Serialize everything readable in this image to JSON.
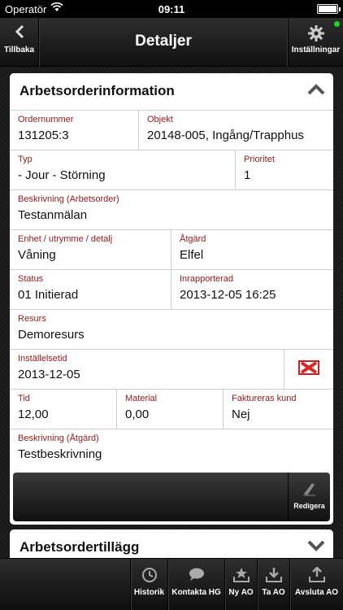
{
  "status_bar": {
    "carrier": "Operatör",
    "time": "09:11",
    "battery_level": 1.0
  },
  "nav": {
    "back_label": "Tillbaka",
    "title": "Detaljer",
    "settings_label": "Inställningar"
  },
  "work_order_panel": {
    "title": "Arbetsorderinformation",
    "fields": {
      "order_number": {
        "label": "Ordernummer",
        "value": "131205:3"
      },
      "object": {
        "label": "Objekt",
        "value": "20148-005, Ingång/Trapphus"
      },
      "type": {
        "label": "Typ",
        "value": "- Jour - Störning"
      },
      "priority": {
        "label": "Prioritet",
        "value": "1"
      },
      "description": {
        "label": "Beskrivning (Arbetsorder)",
        "value": "Testanmälan"
      },
      "unit": {
        "label": "Enhet / utrymme / detalj",
        "value": "Våning"
      },
      "action": {
        "label": "Åtgärd",
        "value": "Elfel"
      },
      "status": {
        "label": "Status",
        "value": "01 Initierad"
      },
      "reported": {
        "label": "Inrapporterad",
        "value": "2013-12-05 16:25"
      },
      "resource": {
        "label": "Resurs",
        "value": "Demoresurs"
      },
      "setting_time": {
        "label": "Inställelsetid",
        "value": "2013-12-05"
      },
      "time": {
        "label": "Tid",
        "value": "12,00"
      },
      "material": {
        "label": "Material",
        "value": "0,00"
      },
      "billed": {
        "label": "Faktureras kund",
        "value": "Nej"
      },
      "action_description": {
        "label": "Beskrivning (Åtgärd)",
        "value": "Testbeskrivning"
      }
    },
    "edit_label": "Redigera"
  },
  "addons_panel": {
    "title": "Arbetsordertillägg"
  },
  "toolbar": {
    "history": "Historik",
    "contact": "Kontakta HG",
    "new": "Ny AO",
    "take": "Ta AO",
    "finish": "Avsluta AO"
  },
  "colors": {
    "field_label": "#8b1a1a",
    "status_indicator": "#22d022"
  }
}
